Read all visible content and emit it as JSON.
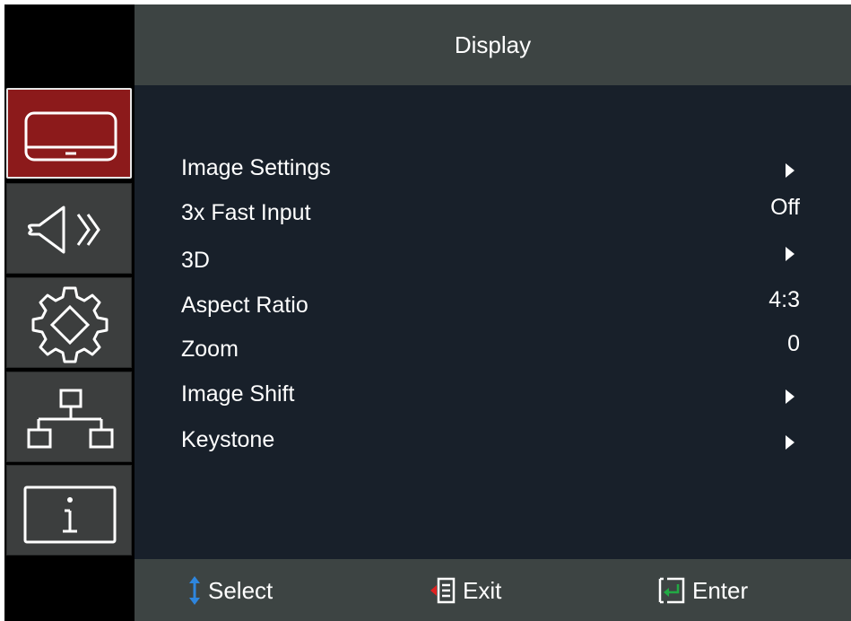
{
  "header": {
    "title": "Display"
  },
  "sidebar": {
    "tabs": [
      {
        "name": "display",
        "icon": "display-icon",
        "active": true
      },
      {
        "name": "audio",
        "icon": "speaker-icon",
        "active": false
      },
      {
        "name": "settings",
        "icon": "gear-icon",
        "active": false
      },
      {
        "name": "network",
        "icon": "network-icon",
        "active": false
      },
      {
        "name": "information",
        "icon": "info-icon",
        "active": false
      }
    ]
  },
  "menu": {
    "items": [
      {
        "label": "Image Settings",
        "value": "",
        "submenu": true
      },
      {
        "label": "3x Fast Input",
        "value": "Off",
        "submenu": false
      },
      {
        "label": "3D",
        "value": "",
        "submenu": true
      },
      {
        "label": "Aspect Ratio",
        "value": "4:3",
        "submenu": false
      },
      {
        "label": "Zoom",
        "value": "0",
        "submenu": false
      },
      {
        "label": "Image Shift",
        "value": "",
        "submenu": true
      },
      {
        "label": "Keystone",
        "value": "",
        "submenu": true
      }
    ]
  },
  "footer": {
    "select_label": "Select",
    "exit_label": "Exit",
    "enter_label": "Enter"
  },
  "colors": {
    "active_tab": "#8c1a1b",
    "header_bg": "#3d4443",
    "main_bg": "#18202a",
    "select_icon": "#2e86de",
    "exit_icon": "#e02020",
    "enter_icon": "#22aa44"
  }
}
